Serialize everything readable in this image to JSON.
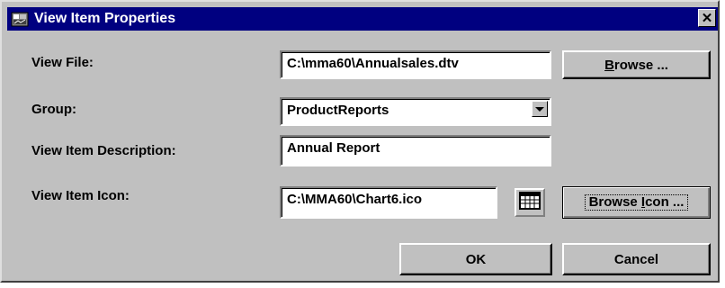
{
  "window": {
    "title": "View Item Properties",
    "close_glyph": "✕",
    "icon": "app-icon"
  },
  "fields": {
    "view_file": {
      "label": "View File:",
      "value": "C:\\mma60\\Annualsales.dtv"
    },
    "group": {
      "label": "Group:",
      "value": "ProductReports"
    },
    "description": {
      "label": "View Item Description:",
      "value": "Annual Report"
    },
    "icon": {
      "label": "View Item Icon:",
      "value": "C:\\MMA60\\Chart6.ico",
      "preview_icon": "spreadsheet-icon"
    }
  },
  "buttons": {
    "browse": {
      "label_pre": "",
      "label_u": "B",
      "label_post": "rowse ..."
    },
    "browse_icon": {
      "label_pre": "Browse ",
      "label_u": "I",
      "label_post": "con ..."
    },
    "ok": "OK",
    "cancel": "Cancel"
  },
  "colors": {
    "titlebar": "#000080",
    "face": "#c0c0c0"
  }
}
